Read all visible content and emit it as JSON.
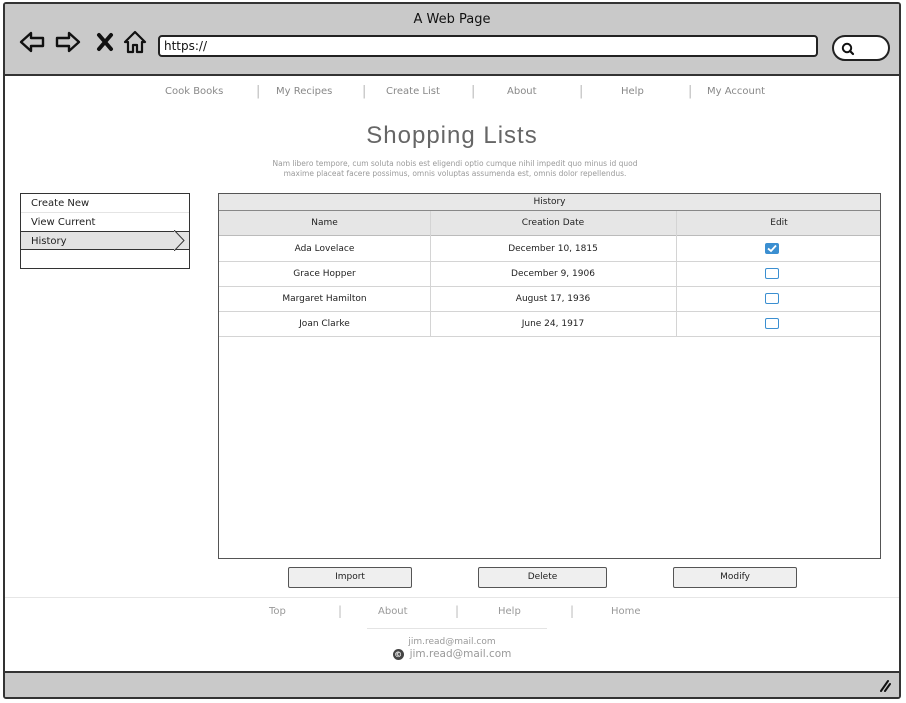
{
  "window": {
    "title": "A Web Page",
    "url": "https://",
    "nav_icons": [
      "back-arrow-icon",
      "forward-arrow-icon",
      "close-x-icon",
      "home-icon"
    ],
    "search_icon": "search-icon"
  },
  "topnav": {
    "items": [
      "Cook Books",
      "My Recipes",
      "Create List",
      "About",
      "Help",
      "My Account"
    ]
  },
  "page": {
    "title": "Shopping Lists",
    "lead_line1": "Nam libero tempore, cum soluta nobis est eligendi optio cumque nihil impedit quo minus id quod",
    "lead_line2": "maxime placeat facere possimus, omnis voluptas assumenda est, omnis dolor repellendus."
  },
  "sidebar": {
    "items": [
      {
        "label": "Create New",
        "selected": false
      },
      {
        "label": "View Current",
        "selected": false
      },
      {
        "label": "History",
        "selected": true
      }
    ]
  },
  "table": {
    "caption": "History",
    "columns": [
      "Name",
      "Creation Date",
      "Edit"
    ],
    "rows": [
      {
        "name": "Ada Lovelace",
        "date": "December 10, 1815",
        "edit": true
      },
      {
        "name": "Grace Hopper",
        "date": "December 9, 1906",
        "edit": false
      },
      {
        "name": "Margaret Hamilton",
        "date": "August 17, 1936",
        "edit": false
      },
      {
        "name": "Joan Clarke",
        "date": "June 24, 1917",
        "edit": false
      }
    ]
  },
  "actions": {
    "import_label": "Import",
    "delete_label": "Delete",
    "modify_label": "Modify"
  },
  "footer": {
    "nav": [
      "Top",
      "About",
      "Help",
      "Home"
    ],
    "email_small": "jim.read@mail.com",
    "email_large": "jim.read@mail.com",
    "copyright_icon": "copyright-icon"
  },
  "colors": {
    "chrome": "#c9c9c9",
    "checkbox_accent": "#3b8fd1",
    "header_bg": "#e6e6e6"
  }
}
